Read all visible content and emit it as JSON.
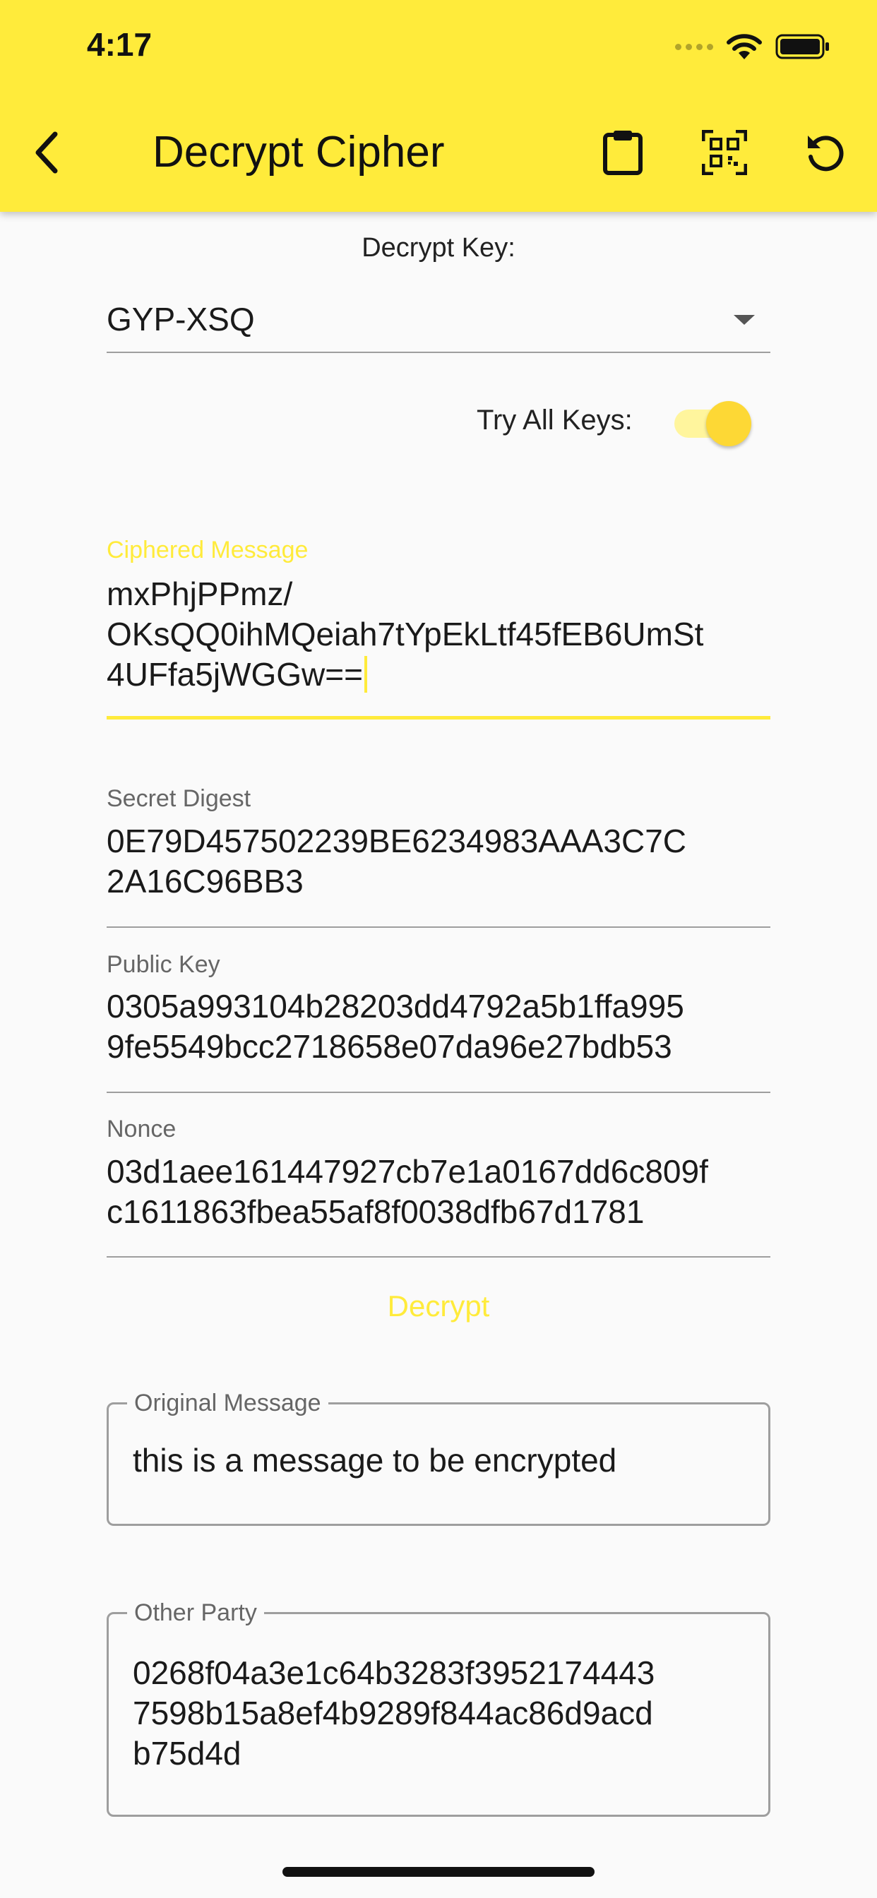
{
  "status_bar": {
    "time": "4:17"
  },
  "app_bar": {
    "title": "Decrypt Cipher",
    "back_icon": "chevron-left-icon",
    "actions": [
      "clipboard-icon",
      "qr-code-scan-icon",
      "refresh-icon"
    ]
  },
  "decrypt_key": {
    "label": "Decrypt Key:",
    "selected": "GYP-XSQ"
  },
  "try_all_keys": {
    "label": "Try All Keys:",
    "enabled": true
  },
  "ciphered_message": {
    "label": "Ciphered Message",
    "lines": [
      "mxPhjPPmz/",
      "OKsQQ0ihMQeiah7tYpEkLtf45fEB6UmSt",
      "4UFfa5jWGGw=="
    ]
  },
  "secret_digest": {
    "label": "Secret Digest",
    "lines": [
      "0E79D457502239BE6234983AAA3C7C",
      "2A16C96BB3"
    ]
  },
  "public_key": {
    "label": "Public Key",
    "lines": [
      "0305a993104b28203dd4792a5b1ffa995",
      "9fe5549bcc2718658e07da96e27bdb53"
    ]
  },
  "nonce": {
    "label": "Nonce",
    "lines": [
      "03d1aee161447927cb7e1a0167dd6c809f",
      "c1611863fbea55af8f0038dfb67d1781"
    ]
  },
  "decrypt_button": {
    "label": "Decrypt"
  },
  "original_message": {
    "label": "Original Message",
    "value": "this is a message to be encrypted"
  },
  "other_party": {
    "label": "Other Party",
    "lines": [
      "0268f04a3e1c64b3283f3952174443",
      "7598b15a8ef4b9289f844ac86d9acd",
      "b75d4d"
    ]
  },
  "colors": {
    "accent": "#ffeb3b",
    "toggle_thumb": "#fdd835",
    "background": "#fafafa"
  }
}
